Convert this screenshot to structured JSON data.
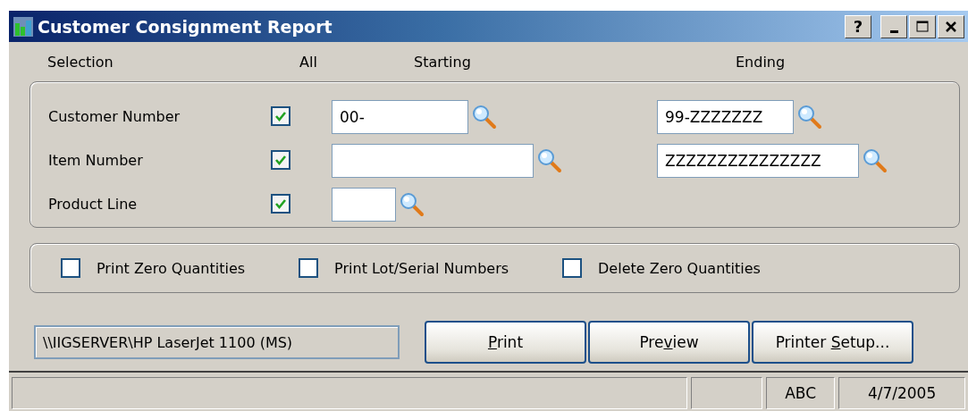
{
  "window": {
    "title": "Customer Consignment Report",
    "buttons": [
      {
        "kind": "help",
        "label": "?"
      },
      {
        "kind": "minimize"
      },
      {
        "kind": "maximize"
      },
      {
        "kind": "close"
      }
    ]
  },
  "selection_headers": {
    "selection": "Selection",
    "all": "All",
    "starting": "Starting",
    "ending": "Ending"
  },
  "selection_rows": [
    {
      "label": "Customer Number",
      "all": true,
      "starting": "00-",
      "ending": "99-ZZZZZZZ"
    },
    {
      "label": "Item Number",
      "all": true,
      "ending": "ZZZZZZZZZZZZZZZ"
    },
    {
      "label": "Product Line",
      "all": true
    }
  ],
  "options": [
    {
      "label": "Print Zero Quantities",
      "checked": false
    },
    {
      "label": "Print Lot/Serial Numbers",
      "checked": false
    },
    {
      "label": "Delete Zero Quantities",
      "checked": false
    }
  ],
  "printer": "\\\\IIGSERVER\\HP LaserJet 1100 (MS)",
  "buttons": [
    {
      "key": "P",
      "after": "rint"
    },
    {
      "before": "Pre",
      "key": "v",
      "after": "iew"
    },
    {
      "before": "Printer ",
      "key": "S",
      "after": "etup..."
    }
  ],
  "status_bar": [
    "ABC",
    "4/7/2005"
  ]
}
